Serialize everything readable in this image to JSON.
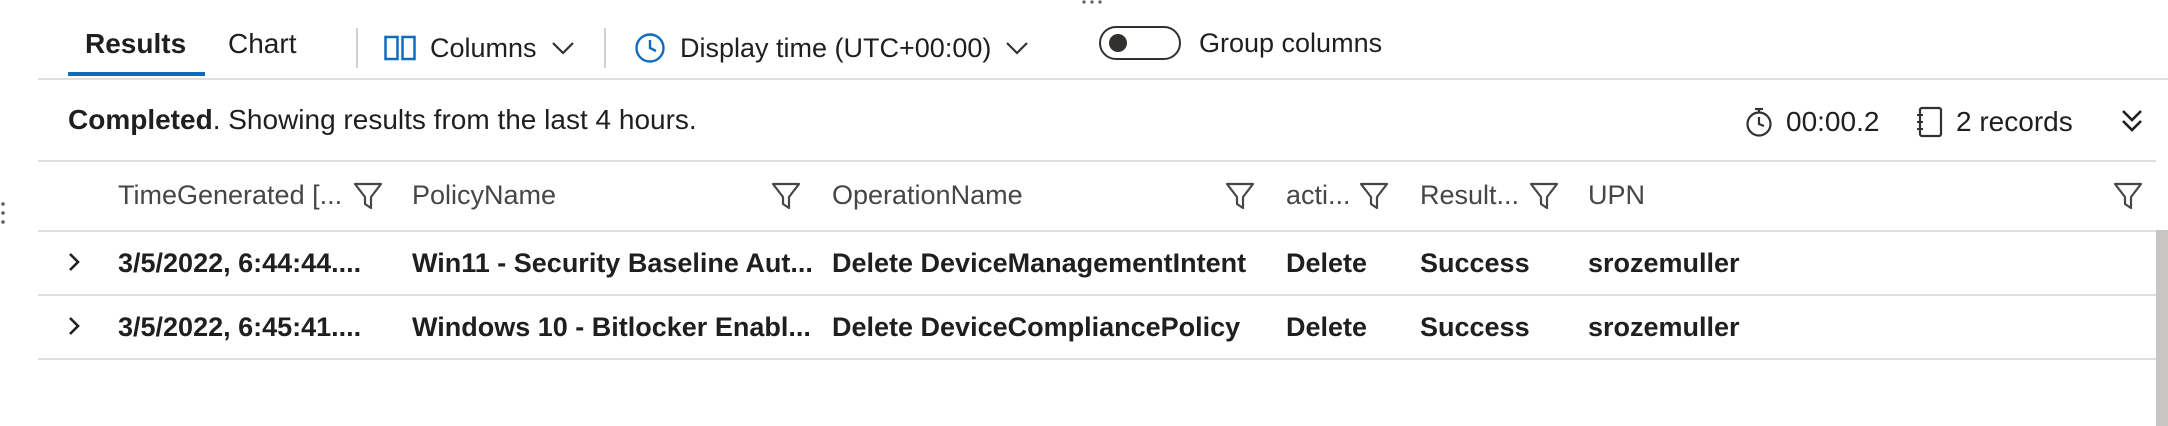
{
  "toolbar": {
    "tabs": [
      {
        "label": "Results",
        "active": true
      },
      {
        "label": "Chart",
        "active": false
      }
    ],
    "columns_label": "Columns",
    "display_time_label": "Display time (UTC+00:00)",
    "group_columns_label": "Group columns",
    "group_columns_on": false
  },
  "status": {
    "bold": "Completed",
    "message": ". Showing results from the last 4 hours.",
    "duration": "00:00.2",
    "records": "2 records"
  },
  "table": {
    "columns": [
      "TimeGenerated [...",
      "PolicyName",
      "OperationName",
      "acti...",
      "Result...",
      "UPN"
    ],
    "rows": [
      [
        "3/5/2022, 6:44:44....",
        "Win11 - Security Baseline Aut...",
        "Delete DeviceManagementIntent",
        "Delete",
        "Success",
        "srozemuller"
      ],
      [
        "3/5/2022, 6:45:41....",
        "Windows 10 - Bitlocker Enabl...",
        "Delete DeviceCompliancePolicy",
        "Delete",
        "Success",
        "srozemuller"
      ]
    ]
  },
  "colors": {
    "accent": "#0f6cbd",
    "text": "#201f1e",
    "divider": "#e1dfdd"
  },
  "icons": [
    "columns-icon",
    "chevron-down-icon",
    "clock-icon",
    "stopwatch-icon",
    "notebook-icon",
    "expand-chevrons-icon",
    "filter-icon",
    "row-expand-chevron-icon"
  ]
}
